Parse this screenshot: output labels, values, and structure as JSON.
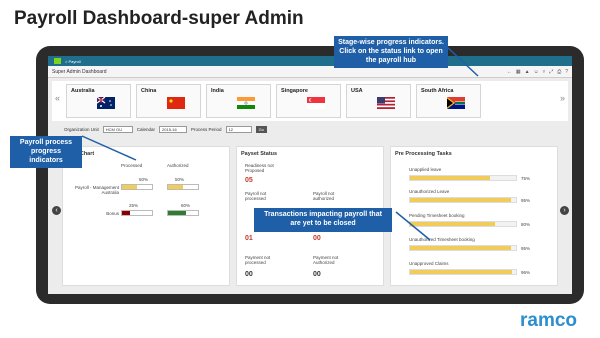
{
  "slide": {
    "title": "Payroll Dashboard-super Admin"
  },
  "app": {
    "breadcrumb": "> Payroll",
    "subtitle": "Super Admin Dashboard"
  },
  "countries": [
    {
      "name": "Australia",
      "flag": "australia-flag"
    },
    {
      "name": "China",
      "flag": "china-flag"
    },
    {
      "name": "India",
      "flag": "india-flag"
    },
    {
      "name": "Singapore",
      "flag": "singapore-flag"
    },
    {
      "name": "USA",
      "flag": "usa-flag"
    },
    {
      "name": "South Africa",
      "flag": "south-africa-flag"
    }
  ],
  "filters": {
    "org_unit_label": "Organization Unit",
    "org_unit_value": "HCM OU",
    "calendar_label": "Calendar",
    "calendar_value": "2015-16",
    "period_label": "Process Period",
    "period_value": "12",
    "go_label": "Go"
  },
  "progress_chart": {
    "title": "ress Chart",
    "col_processed": "Processed",
    "col_authorized": "Authorized",
    "rows": [
      {
        "label": "Payroll - Management Australia",
        "processed": "50%",
        "authorized": "50%",
        "processed_pct": 50,
        "authorized_pct": 50,
        "processed_color": "#f2cc5b",
        "authorized_color": "#f2cc5b"
      },
      {
        "label": "Bonus",
        "processed": "25%",
        "authorized": "60%",
        "processed_pct": 25,
        "authorized_pct": 60,
        "processed_color": "#8b0000",
        "authorized_color": "#2e7d32"
      }
    ]
  },
  "payset_status": {
    "title": "Payset Status",
    "items": [
      {
        "label": "Readiness not Proposed",
        "value": "05"
      },
      {
        "label": "Payroll not processed",
        "value": ""
      },
      {
        "label": "Payroll not authorized",
        "value": ""
      },
      {
        "label": "",
        "value": "01"
      },
      {
        "label": "",
        "value": "00"
      },
      {
        "label": "Payment not processed",
        "value": "00"
      },
      {
        "label": "Payment not Authorized",
        "value": "00"
      }
    ]
  },
  "pre_processing": {
    "title": "Pre Processing Tasks",
    "tasks": [
      {
        "label": "Unapplied leave",
        "pct": "75%",
        "value": 75
      },
      {
        "label": "Unauthorized Leave",
        "pct": "95%",
        "value": 95
      },
      {
        "label": "Pending Timesheet booking",
        "pct": "80%",
        "value": 80
      },
      {
        "label": "Unauthorized Timesheet booking",
        "pct": "95%",
        "value": 95
      },
      {
        "label": "Unapproved Claims",
        "pct": "96%",
        "value": 96
      }
    ]
  },
  "callouts": {
    "stage": "Stage-wise progress indicators. Click on the status link to open the payroll hub",
    "payroll_process": "Payroll process progress indicators",
    "transactions": "Transactions impacting payroll that are yet to be closed"
  },
  "brand": {
    "logo": "ramco"
  }
}
